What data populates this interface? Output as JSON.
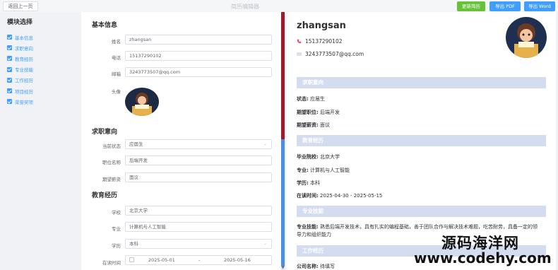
{
  "topbar": {
    "back_label": "返回上一页",
    "page_title": "简历编辑器",
    "update_label": "更新简历",
    "pdf_label": "导出 PDF",
    "word_label": "导出 Word"
  },
  "sidebar": {
    "title": "模块选择",
    "items": [
      "基本信息",
      "求职意向",
      "教育经历",
      "专业技能",
      "工作经历",
      "项目经历",
      "荣誉奖项"
    ]
  },
  "editor": {
    "basic": {
      "title": "基本信息",
      "name_label": "姓名",
      "name_value": "zhangsan",
      "phone_label": "电话",
      "phone_value": "15137290102",
      "email_label": "邮箱",
      "email_value": "3243773507@qq.com",
      "avatar_label": "头像"
    },
    "intent": {
      "title": "求职意向",
      "status_label": "当前状态",
      "status_value": "应届生",
      "position_label": "职位名称",
      "position_value": "后端开发",
      "salary_label": "期望薪资",
      "salary_value": "面议"
    },
    "education": {
      "title": "教育经历",
      "school_label": "学校",
      "school_value": "北京大学",
      "major_label": "专业",
      "major_value": "计算机与人工智能",
      "degree_label": "学历",
      "degree_value": "本科",
      "time_label": "在读时间",
      "start": "2025-05-01",
      "sep": "-",
      "end": "2025-05-16"
    }
  },
  "preview": {
    "name": "zhangsan",
    "phone": "15137290102",
    "email": "3243773507@qq.com",
    "sections": {
      "intent": "求职意向",
      "education": "教育经历",
      "skills": "专业技能",
      "work": "工作经历"
    },
    "intent_rows": {
      "status_k": "状态:",
      "status_v": "应届生",
      "pos_k": "期望职位:",
      "pos_v": "后端开发",
      "salary_k": "期望薪资:",
      "salary_v": "面议"
    },
    "edu_rows": {
      "school_k": "毕业院校:",
      "school_v": "北京大学",
      "major_k": "专业:",
      "major_v": "计算机与人工智能",
      "degree_k": "学历:",
      "degree_v": "本科",
      "time_k": "在读时间:",
      "time_v": "2025-04-30 - 2025-05-15"
    },
    "skills_k": "专业技能:",
    "skills_v": "熟悉后端开发技术，具有扎实的编程基础，善于团队合作与解决技术难题，吃苦耐劳，具备一定的领导力和组织能力",
    "work_k": "公司名称:",
    "work_v": "待填写"
  },
  "watermark": {
    "line1": "源码海洋网",
    "line2": "www.codehy.com"
  },
  "colors": {
    "primary": "#409eff",
    "success": "#67c23a",
    "section_bg": "#d4ddf0",
    "phone_icon": "#e0506a",
    "split_red": "#9b1c2c",
    "split_blue": "#4a90e2"
  }
}
